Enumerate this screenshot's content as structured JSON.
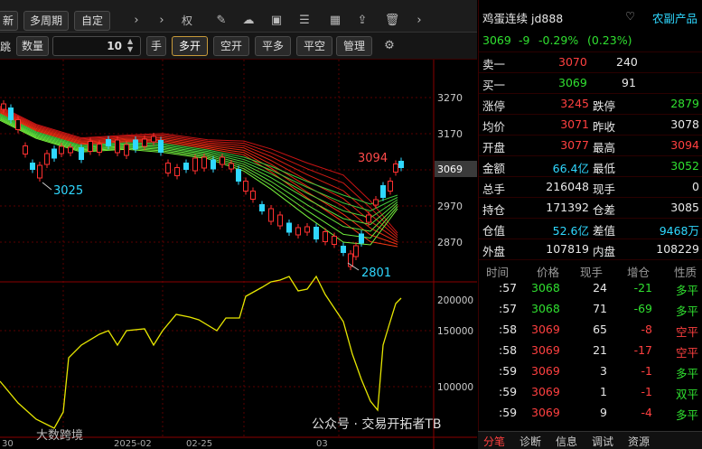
{
  "toolbar1": {
    "items": [
      "新",
      "多周期",
      "自定",
      "权"
    ]
  },
  "toolbar2": {
    "jump": "跳",
    "qty_label": "数量",
    "qty_value": "10",
    "unit": "手",
    "buttons": [
      "多开",
      "空开",
      "平多",
      "平空",
      "管理"
    ]
  },
  "chart": {
    "price_axis": [
      "3270",
      "3170",
      "3069",
      "2970",
      "2870"
    ],
    "price_labels": {
      "high": "3094",
      "low": "2801",
      "left": "3025"
    },
    "vol_axis": [
      "200000",
      "150000",
      "100000"
    ],
    "dates": [
      "30",
      "2025-02",
      "02-25",
      "03"
    ]
  },
  "quote": {
    "name": "鸡蛋连续 jd888",
    "category": "农副产品",
    "price": "3069",
    "change": "-9",
    "change_pct": "-0.29%",
    "extra_pct": "(0.23%)",
    "ask_label": "卖一",
    "ask_price": "3070",
    "ask_vol": "240",
    "bid_label": "买一",
    "bid_price": "3069",
    "bid_vol": "91",
    "stats": [
      [
        "涨停",
        "3245",
        "跌停",
        "2879"
      ],
      [
        "均价",
        "3071",
        "昨收",
        "3078"
      ],
      [
        "开盘",
        "3077",
        "最高",
        "3094"
      ],
      [
        "金额",
        "66.4亿",
        "最低",
        "3052"
      ],
      [
        "总手",
        "216048",
        "现手",
        "0"
      ],
      [
        "持仓",
        "171392",
        "仓差",
        "3085"
      ],
      [
        "仓值",
        "52.6亿",
        "差值",
        "9468万"
      ],
      [
        "外盘",
        "107819",
        "内盘",
        "108229"
      ]
    ],
    "trades_header": [
      "时间",
      "价格",
      "现手",
      "增仓",
      "性质"
    ],
    "trades": [
      [
        ":57",
        "3068",
        "24",
        "-21",
        "多平"
      ],
      [
        ":57",
        "3068",
        "71",
        "-69",
        "多平"
      ],
      [
        ":58",
        "3069",
        "65",
        "-8",
        "空平"
      ],
      [
        ":58",
        "3069",
        "21",
        "-17",
        "空平"
      ],
      [
        ":59",
        "3069",
        "3",
        "-1",
        "多平"
      ],
      [
        ":59",
        "3069",
        "1",
        "-1",
        "双平"
      ],
      [
        ":59",
        "3069",
        "9",
        "-4",
        "多平"
      ]
    ],
    "tabs": [
      "分笔",
      "诊断",
      "信息",
      "调试",
      "资源"
    ]
  },
  "watermark": {
    "left": "大数跨境",
    "right": "公众号 · 交易开拓者TB"
  }
}
